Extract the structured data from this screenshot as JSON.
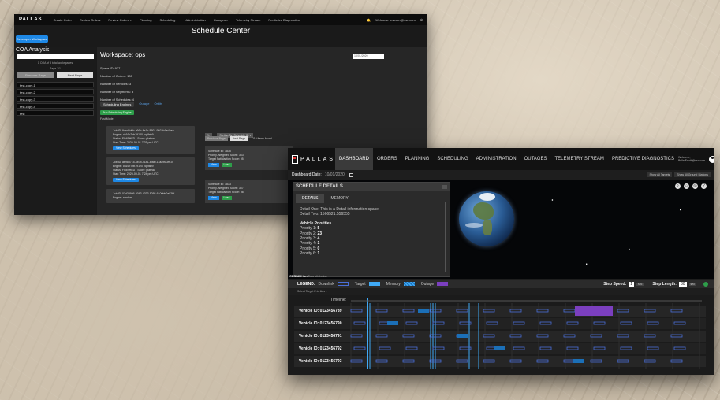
{
  "back_window": {
    "logo": "PALLAS",
    "nav": [
      "Create Order",
      "Review Orders",
      "Review Orders ▾",
      "Planning",
      "Scheduling ▾",
      "Administration",
      "Outages ▾",
      "Telemetry Stream",
      "Predictive Diagnostics"
    ],
    "user": "Welcome testuser@ssc.com",
    "page_title": "Schedule Center",
    "developer_button": "Developer Workspace",
    "coa": {
      "title": "COA Analysis",
      "small": "1 COA of 5 total workspaces",
      "page": "Page 1/1",
      "prev": "Previous Page",
      "next": "Next Page",
      "items": [
        "test-copy-1",
        "test-copy-2",
        "test-copy-3",
        "test-copy-4",
        "test"
      ]
    },
    "workspace": {
      "title": "Workspace: ops",
      "date": "10/01/2020",
      "space_id": "Space ID: 937",
      "orders": "Number of Orders: 100",
      "vehicles": "Number of Vehicles: 3",
      "segments": "Number of Segments: 3",
      "schedules": "Number of Schedules: 4",
      "tabs": [
        "Scheduling Engines",
        "Outage",
        "Orbits"
      ],
      "run_button": "Run Scheduling Engine",
      "fast_mode": "Fast Mode",
      "jobs": [
        {
          "id": "Job ID: 9cad3d6b-a66b-4e1b-8501-9801fc5e4aeb",
          "engine": "Engine: ch16b7bb19120 bq0fab9",
          "status": "Status: FINISHED · Score: plateau",
          "start": "Start Time: 2020-09-01 7:31 pm UTC",
          "button": "View Schedules"
        },
        {
          "id": "Job ID: ae988715-4b7b-4181-ad60-11aa9fa3ff10",
          "engine": "Engine: ch16b7bb19120 bq0fab9",
          "status": "Status: FINISHED · Score: plateau",
          "start": "Start Time: 2020-09-01 7:24 pm UTC",
          "button": "View Schedules"
        },
        {
          "id": "Job ID: 03d33906-8063-4333-8058-6100bb0a02bf",
          "engine": "Engine: random",
          "status": "",
          "start": "",
          "button": ""
        }
      ],
      "sort": "Sorting By: Schedule ID ▾",
      "prev": "Previous Page",
      "next": "Next Page",
      "found": "110 items found",
      "schedules_list": [
        {
          "id": "Schedule ID: 1835",
          "priority": "Priority-Weighted Score: 363",
          "target": "Target Satisfaction Score: 95",
          "view": "View",
          "load": "Load"
        },
        {
          "id": "Schedule ID: 1833",
          "priority": "Priority-Weighted Score: 357",
          "target": "Target Satisfaction Score: 98",
          "view": "View",
          "load": "Load"
        }
      ]
    }
  },
  "front_window": {
    "logo": "PALLAS",
    "nav": [
      "DASHBOARD",
      "ORDERS",
      "PLANNING",
      "SCHEDULING",
      "ADMINISTRATION",
      "OUTAGES",
      "TELEMETRY STREAM",
      "PREDICTIVE DIAGNOSTICS"
    ],
    "active_nav": "DASHBOARD",
    "welcome": "Welcome,",
    "user": "Bella.Fauth@ssc.com",
    "dashboard_date_label": "Dashboard Date:",
    "dashboard_date": "10/01/2020",
    "show_targets": "Show All Targets",
    "show_stations": "Show All Ground Stations",
    "details": {
      "title": "SCHEDULE DETAILS",
      "tabs": [
        "DETAILS",
        "MEMORY"
      ],
      "line1": "Detail One: This is a Detail information space.",
      "line2": "Detail Two: 1566521.556555",
      "priorities_title": "Vehicle Priorities",
      "priorities": [
        {
          "label": "Priority 1:",
          "value": "5"
        },
        {
          "label": "Priority 2:",
          "value": "23"
        },
        {
          "label": "Priority 3:",
          "value": "4"
        },
        {
          "label": "Priority 4:",
          "value": "1"
        },
        {
          "label": "Priority 5:",
          "value": "0"
        },
        {
          "label": "Priority 6:",
          "value": "1"
        }
      ]
    },
    "cesium": "CESIUM ion",
    "cesium_note": "Data attribution",
    "legend": {
      "title": "LEGEND:",
      "downlink": "Downlink",
      "target": "Target",
      "memory": "Memory",
      "outage": "Outage",
      "step_speed": "Step Speed:",
      "step_speed_value": "1",
      "step_speed_unit": "sec",
      "step_length": "Step Length:",
      "step_length_value": "30",
      "step_length_unit": "sec"
    },
    "filter_label": "Select Target Priorities ▾",
    "timeline_label": "Timeline:",
    "vehicles": [
      "Vehicle ID: 0123456789",
      "Vehicle ID: 0123456790",
      "Vehicle ID: 0123456791",
      "Vehicle ID: 0123456792",
      "Vehicle ID: 0123456793"
    ],
    "colors": {
      "downlink": "#4a6fd8",
      "target": "#3fa9f5",
      "memory": "#1b6fb7",
      "outage": "#7b3fbf"
    }
  }
}
